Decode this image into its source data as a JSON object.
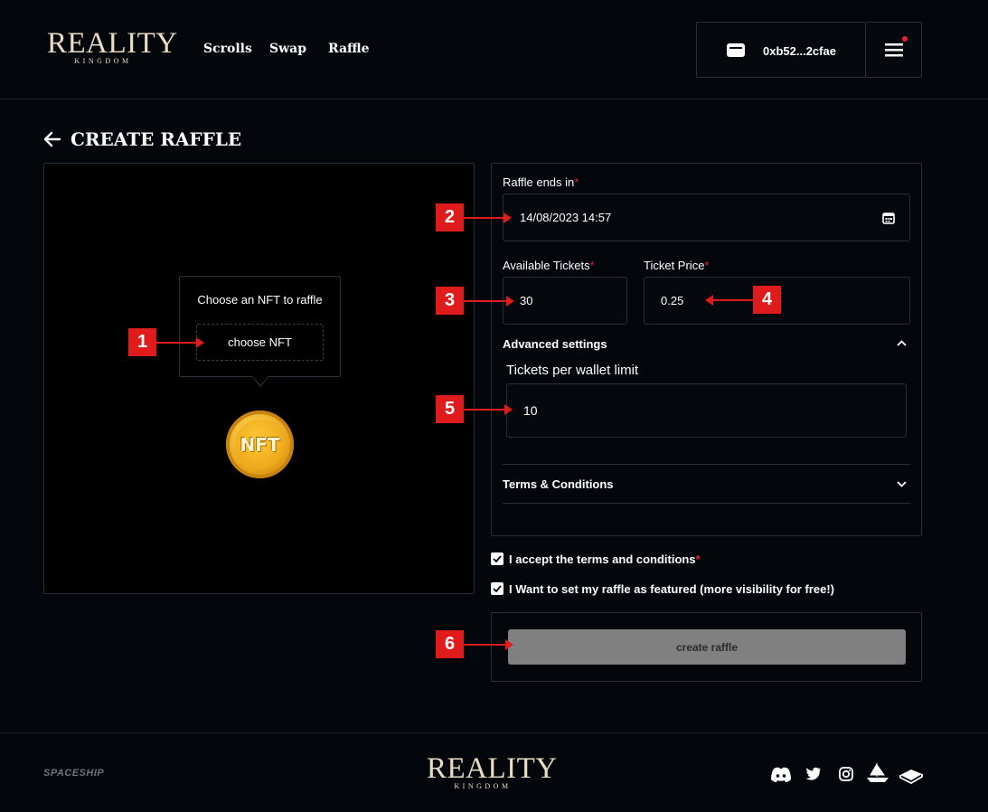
{
  "brand": {
    "logo_main": "REALITY",
    "logo_sub": "KINGDOM"
  },
  "nav": {
    "items": [
      "Scrolls",
      "Swap",
      "Raffle"
    ]
  },
  "wallet": {
    "address": "0xb52...2cfae",
    "icon": "wallet-icon",
    "notification_dot_color": "#e0242f"
  },
  "menu": {
    "icon": "hamburger-menu-icon"
  },
  "page": {
    "title": "CREATE RAFFLE",
    "back_icon": "arrow-left-icon"
  },
  "nft_picker": {
    "prompt": "Choose an NFT to raffle",
    "button_label": "choose NFT",
    "placeholder_icon": "nft-coin-icon",
    "coin_text": "NFT"
  },
  "form": {
    "end_label": "Raffle ends in",
    "end_value": "14/08/2023 14:57",
    "tickets_label": "Available Tickets",
    "tickets_value": "30",
    "price_label": "Ticket Price",
    "price_value": "0.25",
    "required_mark": "*",
    "advanced_label": "Advanced settings",
    "wallet_limit_label": "Tickets per wallet limit",
    "wallet_limit_value": "10",
    "terms_label": "Terms & Conditions"
  },
  "checkboxes": {
    "accept_terms": {
      "label": "I accept the terms and conditions",
      "checked": true
    },
    "featured": {
      "label": "I Want to set my raffle as featured (more visibility for free!)",
      "checked": true
    }
  },
  "submit": {
    "label": "create raffle"
  },
  "footer": {
    "partner": "SPACESHIP",
    "socials": [
      "discord-icon",
      "twitter-icon",
      "instagram-icon",
      "ship-icon",
      "book-icon"
    ]
  },
  "annotations": [
    "1",
    "2",
    "3",
    "4",
    "5",
    "6"
  ],
  "colors": {
    "background": "#03070c",
    "accent_required": "#e0242f",
    "annotation_red": "#e01b1b",
    "button_disabled": "#808080",
    "gold": "#e8a419"
  }
}
